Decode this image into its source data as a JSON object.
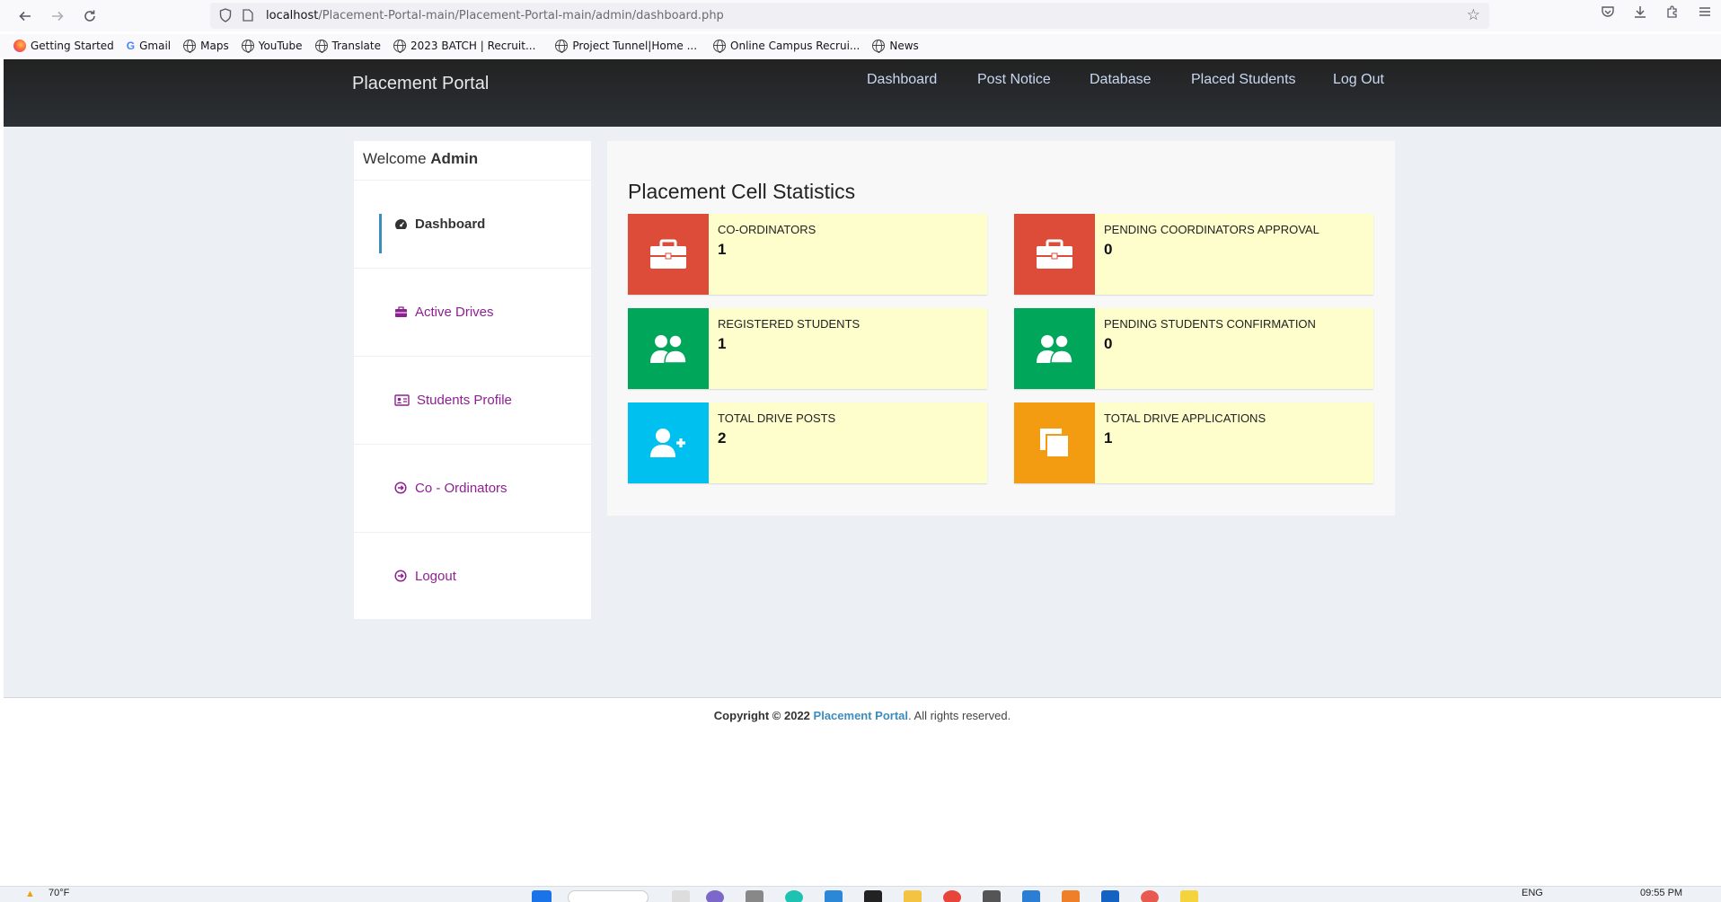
{
  "browser": {
    "url_host": "localhost",
    "url_path": "/Placement-Portal-main/Placement-Portal-main/admin/dashboard.php",
    "bookmarks": [
      "Getting Started",
      "Gmail",
      "Maps",
      "YouTube",
      "Translate",
      "2023 BATCH | Recruit...",
      "Project Tunnel|Home ...",
      "Online Campus Recrui...",
      "News"
    ]
  },
  "navbar": {
    "brand": "Placement Portal",
    "links": [
      "Dashboard",
      "Post Notice",
      "Database",
      "Placed Students",
      "Log Out"
    ]
  },
  "sidebar": {
    "welcome_prefix": "Welcome",
    "welcome_user": "Admin",
    "items": [
      {
        "label": "Dashboard",
        "icon": "dashboard-icon"
      },
      {
        "label": "Active Drives",
        "icon": "briefcase-icon"
      },
      {
        "label": "Students Profile",
        "icon": "id-card-icon"
      },
      {
        "label": "Co - Ordinators",
        "icon": "arrow-circle-icon"
      },
      {
        "label": "Logout",
        "icon": "arrow-circle-icon"
      }
    ]
  },
  "main": {
    "title": "Placement Cell Statistics",
    "cards": [
      {
        "label": "CO-ORDINATORS",
        "value": "1",
        "color": "#dd4b39",
        "icon": "briefcase-icon"
      },
      {
        "label": "PENDING COORDINATORS APPROVAL",
        "value": "0",
        "color": "#dd4b39",
        "icon": "briefcase-icon"
      },
      {
        "label": "REGISTERED STUDENTS",
        "value": "1",
        "color": "#00a65a",
        "icon": "users-icon"
      },
      {
        "label": "PENDING STUDENTS CONFIRMATION",
        "value": "0",
        "color": "#00a65a",
        "icon": "users-icon"
      },
      {
        "label": "TOTAL DRIVE POSTS",
        "value": "2",
        "color": "#00c0ef",
        "icon": "user-plus-icon"
      },
      {
        "label": "TOTAL DRIVE APPLICATIONS",
        "value": "1",
        "color": "#f39c12",
        "icon": "copy-icon"
      }
    ]
  },
  "footer": {
    "prefix": "Copyright © 2022",
    "brand": "Placement Portal",
    "suffix": ". All rights reserved."
  },
  "taskbar": {
    "weather": "70°F",
    "lang": "ENG",
    "time": "09:55 PM"
  }
}
